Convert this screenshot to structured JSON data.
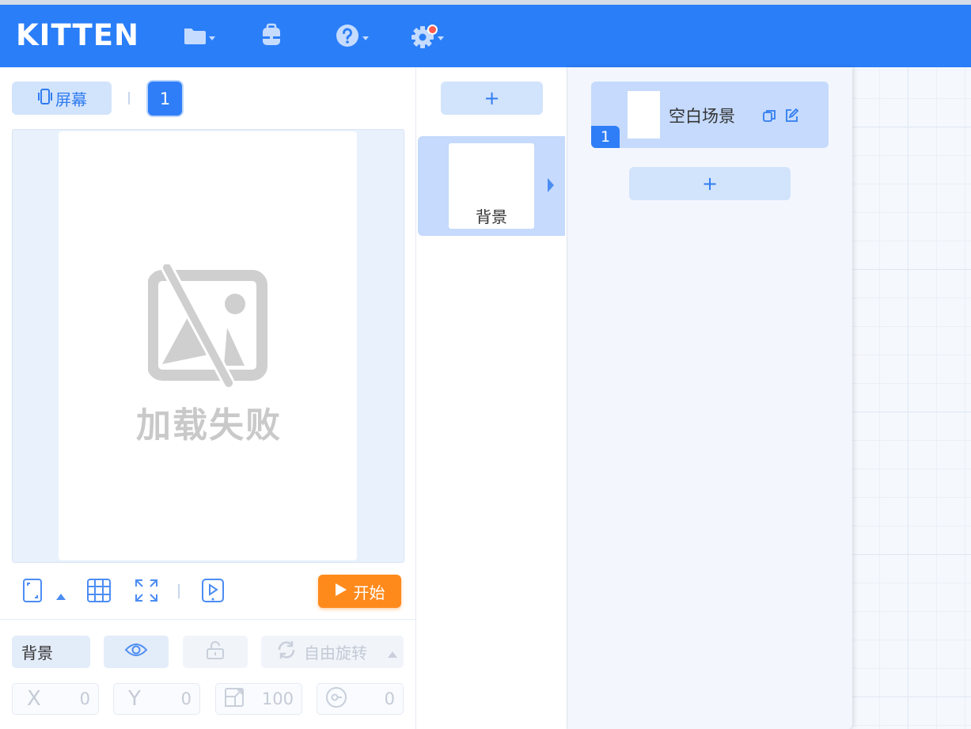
{
  "app": {
    "logo": "KITTEN"
  },
  "header": {
    "colors": {
      "bar": "#2a7ef8"
    },
    "menu": [
      {
        "name": "file-menu",
        "icon": "folder-icon"
      },
      {
        "name": "backpack",
        "icon": "backpack-icon"
      },
      {
        "name": "help-menu",
        "icon": "question-icon"
      },
      {
        "name": "settings-menu",
        "icon": "gear-icon",
        "notification": true
      }
    ]
  },
  "stage_panel": {
    "screen_button": "屏幕",
    "screen_number": "1",
    "load_failed": "加载失败",
    "start_button": "开始"
  },
  "properties": {
    "object_name": "背景",
    "rotation_mode": "自由旋转",
    "x_label": "X",
    "x_value": "0",
    "y_label": "Y",
    "y_value": "0",
    "scale_value": "100",
    "direction_value": "0"
  },
  "roles_column": {
    "add_label": "+",
    "background_label": "背景"
  },
  "scenes_column": {
    "scene_name": "空白场景",
    "scene_number": "1",
    "add_label": "+"
  }
}
